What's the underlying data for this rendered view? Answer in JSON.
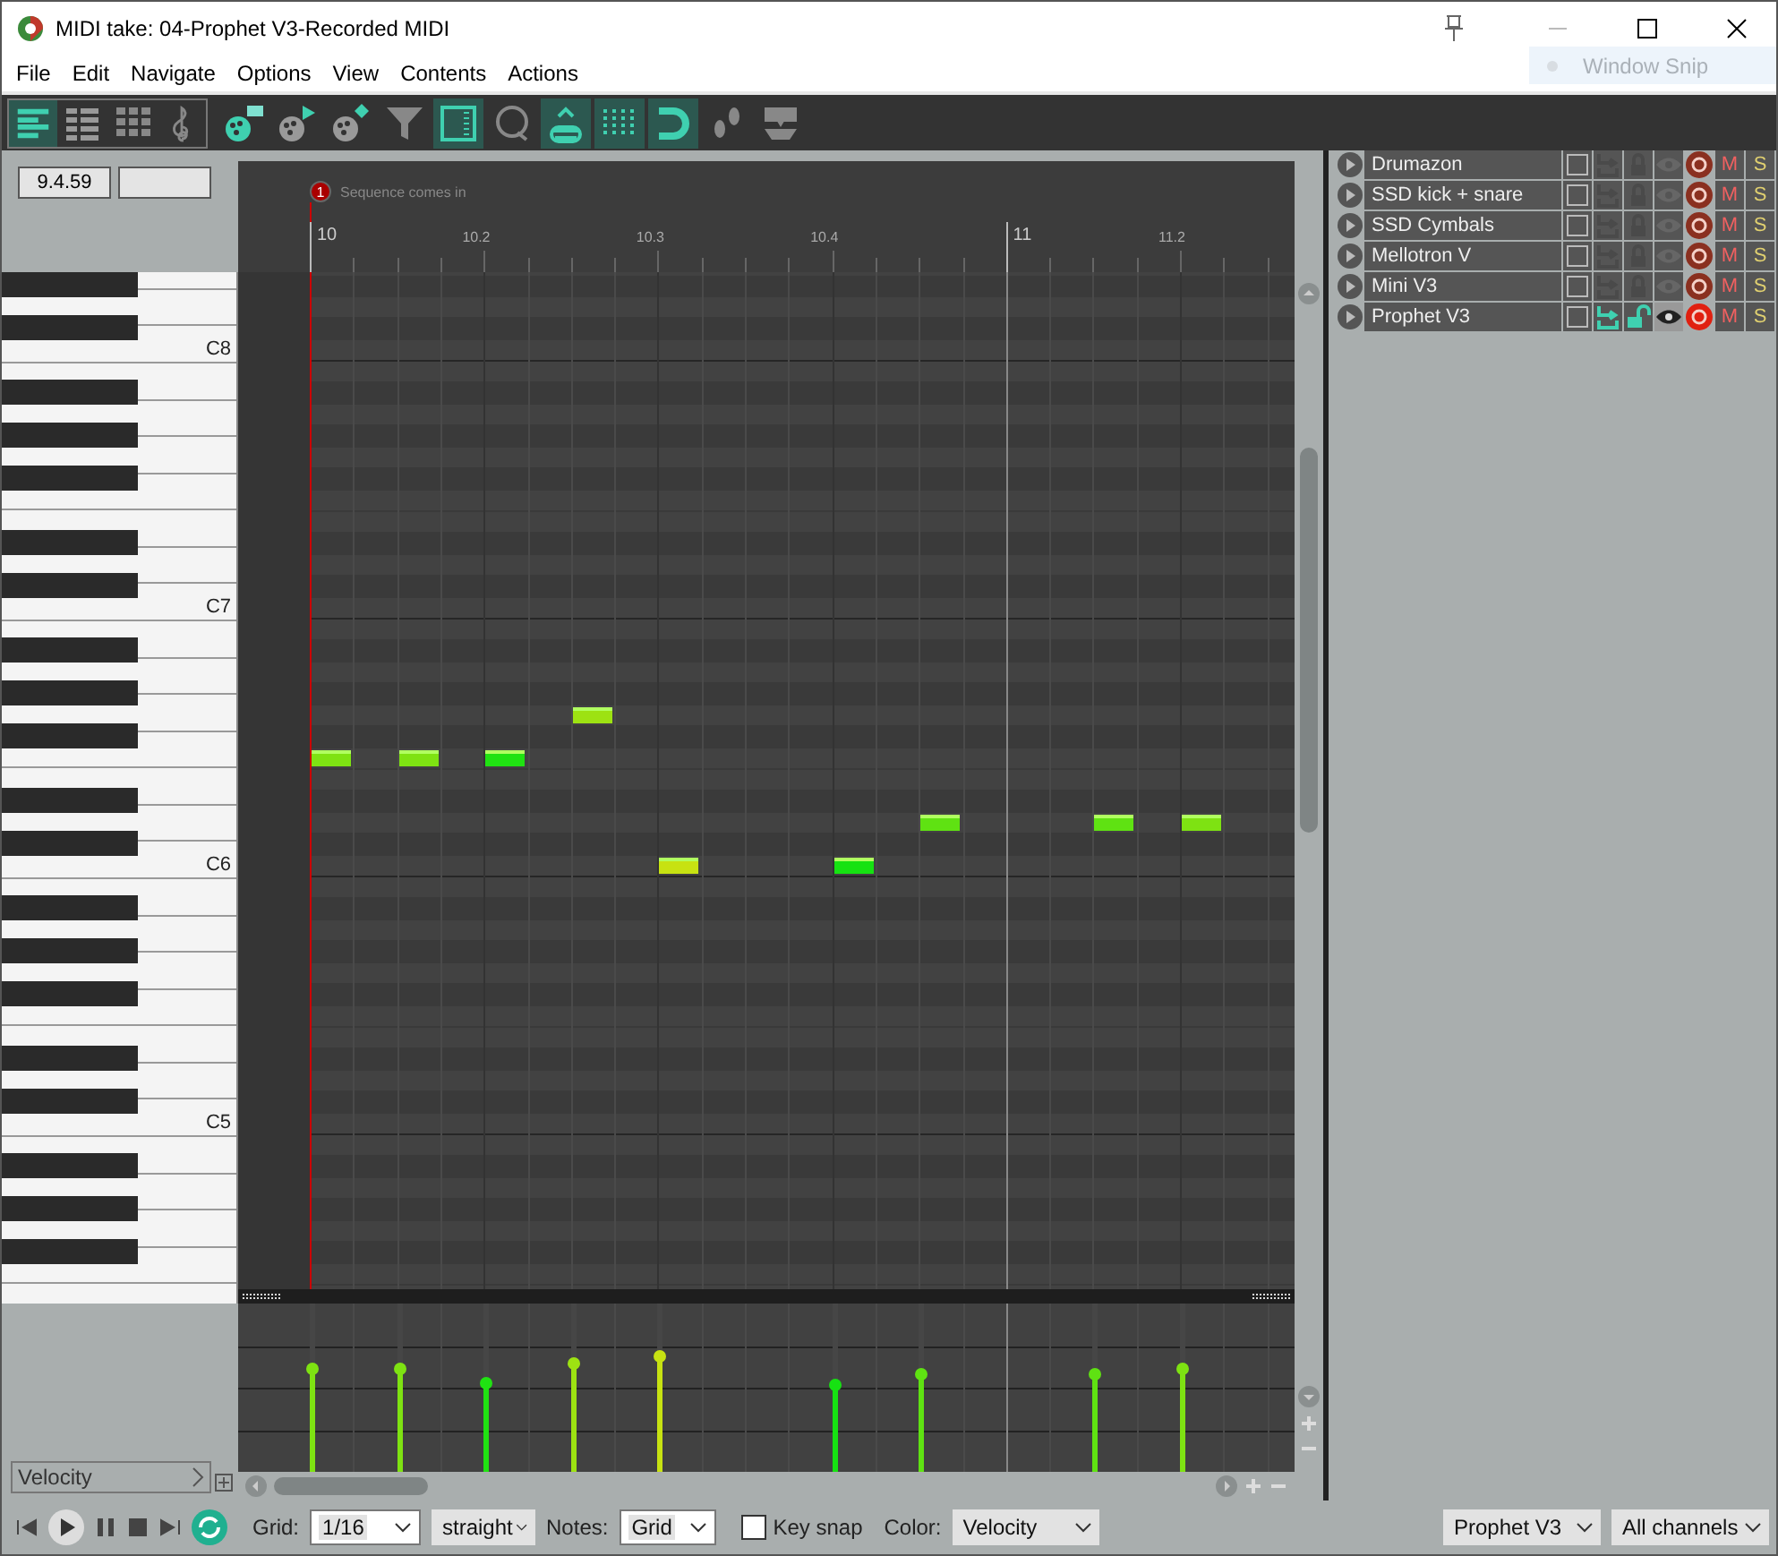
{
  "window": {
    "title": "MIDI take: 04-Prophet V3-Recorded MIDI",
    "snip_hint": "Window Snip"
  },
  "menu": [
    "File",
    "Edit",
    "Navigate",
    "Options",
    "View",
    "Contents",
    "Actions"
  ],
  "toolbar": [
    {
      "on": true
    },
    {
      "on": false
    },
    {
      "on": false
    },
    {
      "on": false
    },
    {
      "on": false
    },
    {
      "on": false
    },
    {
      "on": false
    },
    {
      "on": false
    },
    {
      "on": true
    },
    {
      "on": false
    },
    {
      "on": true
    },
    {
      "on": true
    },
    {
      "on": true
    },
    {
      "on": false
    },
    {
      "on": false
    }
  ],
  "time_field": "9.4.59",
  "ruler": {
    "marker": {
      "number": "1",
      "label": "Sequence comes in"
    },
    "labels": [
      "10",
      "10.2",
      "10.3",
      "10.4",
      "11",
      "11.2"
    ]
  },
  "keyboard": {
    "labels": [
      "C8",
      "C7",
      "C6",
      "C5"
    ]
  },
  "notes": [
    {
      "level": 0.62
    },
    {
      "level": 0.62
    },
    {
      "level": 0.53
    },
    {
      "level": 0.65
    },
    {
      "level": 0.69
    },
    {
      "level": 0.52
    },
    {
      "level": 0.59
    },
    {
      "level": 0.59
    },
    {
      "level": 0.62
    }
  ],
  "lane": {
    "type": "Velocity"
  },
  "bottom": {
    "grid_label": "Grid:",
    "grid": "1/16",
    "swing": "straight",
    "notes_label": "Notes:",
    "notes": "Grid",
    "key_snap": {
      "label": "Key snap",
      "checked": false
    },
    "color_label": "Color:",
    "color_mode": "Velocity",
    "track": "Prophet V3",
    "channels": "All channels"
  },
  "tracks": [
    {
      "name": "Drumazon",
      "selected": false,
      "checked": false,
      "mute": "M",
      "solo": "S"
    },
    {
      "name": "SSD kick + snare",
      "selected": false,
      "checked": false,
      "mute": "M",
      "solo": "S"
    },
    {
      "name": "SSD  Cymbals",
      "selected": false,
      "checked": false,
      "mute": "M",
      "solo": "S"
    },
    {
      "name": "Mellotron V",
      "selected": false,
      "checked": false,
      "mute": "M",
      "solo": "S"
    },
    {
      "name": "Mini V3",
      "selected": false,
      "checked": false,
      "mute": "M",
      "solo": "S"
    },
    {
      "name": "Prophet V3",
      "selected": true,
      "checked": false,
      "mute": "M",
      "solo": "S"
    }
  ]
}
